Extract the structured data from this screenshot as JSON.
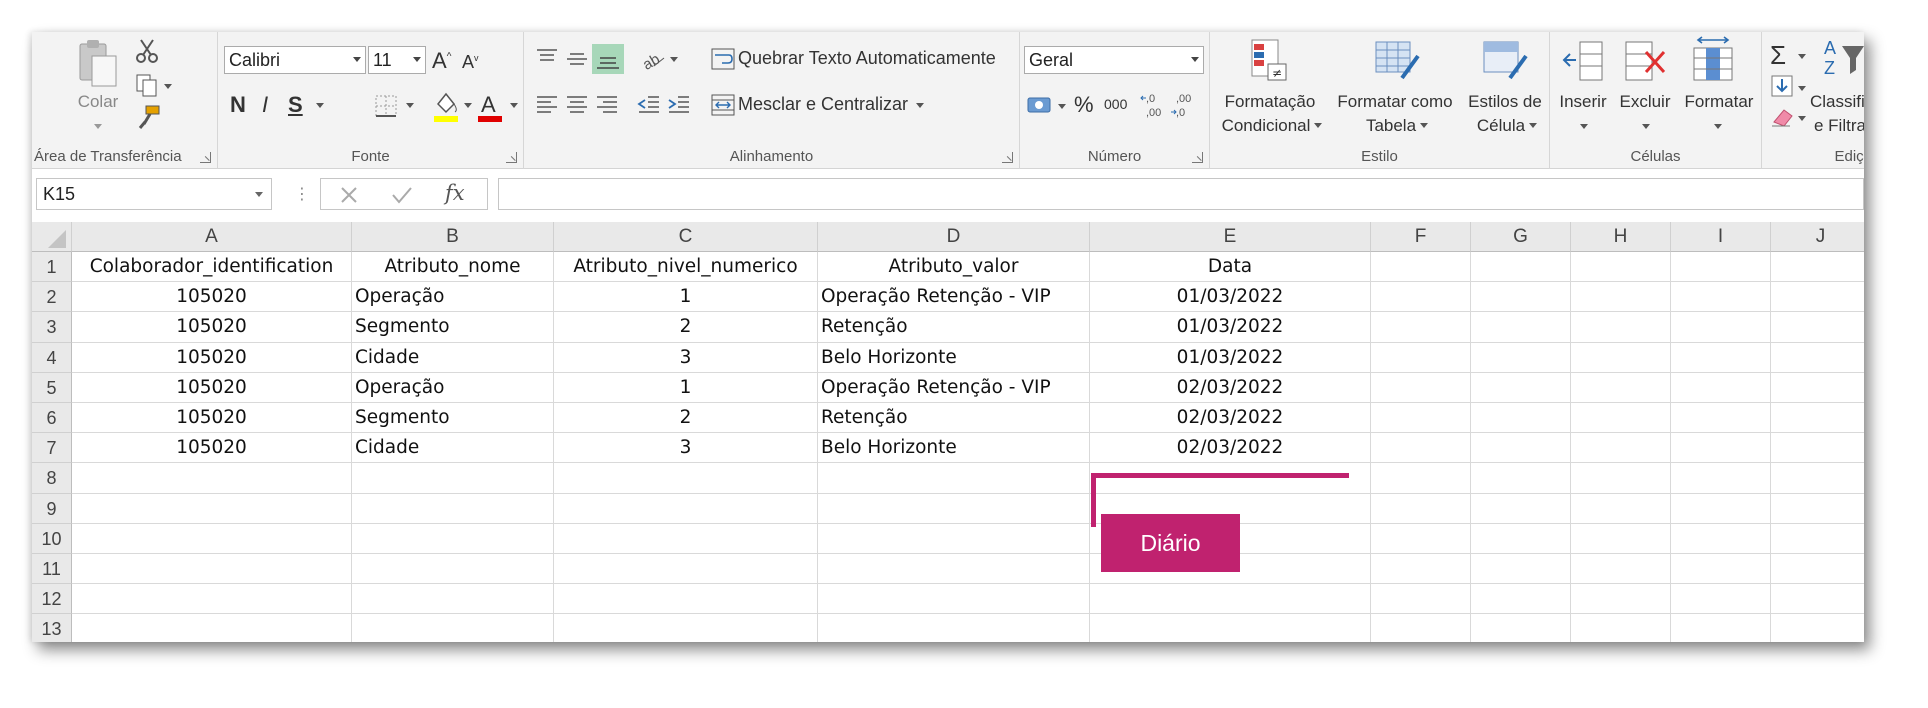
{
  "ribbon": {
    "clipboard": {
      "label": "Área de Transferência",
      "paste_label": "Colar"
    },
    "font": {
      "label": "Fonte",
      "font_name": "Calibri",
      "font_size": "11",
      "bold": "N",
      "italic": "I",
      "underline": "S"
    },
    "alignment": {
      "label": "Alinhamento",
      "wrap_text": "Quebrar Texto Automaticamente",
      "merge_center": "Mesclar e Centralizar"
    },
    "number": {
      "label": "Número",
      "format": "Geral",
      "percent": "%",
      "thousands": "000"
    },
    "styles": {
      "label": "Estilo",
      "conditional_line1": "Formatação",
      "conditional_line2": "Condicional",
      "table_line1": "Formatar como",
      "table_line2": "Tabela",
      "cell_styles_line1": "Estilos de",
      "cell_styles_line2": "Célula"
    },
    "cells": {
      "label": "Células",
      "insert": "Inserir",
      "delete": "Excluir",
      "format": "Formatar"
    },
    "editing": {
      "label": "Ediçã",
      "sort_line1": "Classificar",
      "sort_line2": "e Filtrar"
    }
  },
  "formula_bar": {
    "name_box": "K15",
    "fx": "fx",
    "formula": ""
  },
  "grid": {
    "columns": [
      "A",
      "B",
      "C",
      "D",
      "E",
      "F",
      "G",
      "H",
      "I",
      "J"
    ],
    "row_numbers": [
      "1",
      "2",
      "3",
      "4",
      "5",
      "6",
      "7",
      "8",
      "9",
      "10",
      "11",
      "12",
      "13"
    ],
    "header_row": [
      "Colaborador_identification",
      "Atributo_nome",
      "Atributo_nivel_numerico",
      "Atributo_valor",
      "Data"
    ],
    "rows": [
      [
        "105020",
        "Operação",
        "1",
        "Operação Retenção - VIP",
        "01/03/2022"
      ],
      [
        "105020",
        "Segmento",
        "2",
        "Retenção",
        "01/03/2022"
      ],
      [
        "105020",
        "Cidade",
        "3",
        "Belo Horizonte",
        "01/03/2022"
      ],
      [
        "105020",
        "Operação",
        "1",
        "Operação Retenção - VIP",
        "02/03/2022"
      ],
      [
        "105020",
        "Segmento",
        "2",
        "Retenção",
        "02/03/2022"
      ],
      [
        "105020",
        "Cidade",
        "3",
        "Belo Horizonte",
        "02/03/2022"
      ]
    ]
  },
  "annotation": {
    "label": "Diário",
    "color": "#c0226f"
  },
  "colors": {
    "fill_highlight": "#ffff00",
    "font_color": "#e00000",
    "ribbon_bg": "#f3f3f3",
    "header_bg": "#e9e9e9"
  }
}
